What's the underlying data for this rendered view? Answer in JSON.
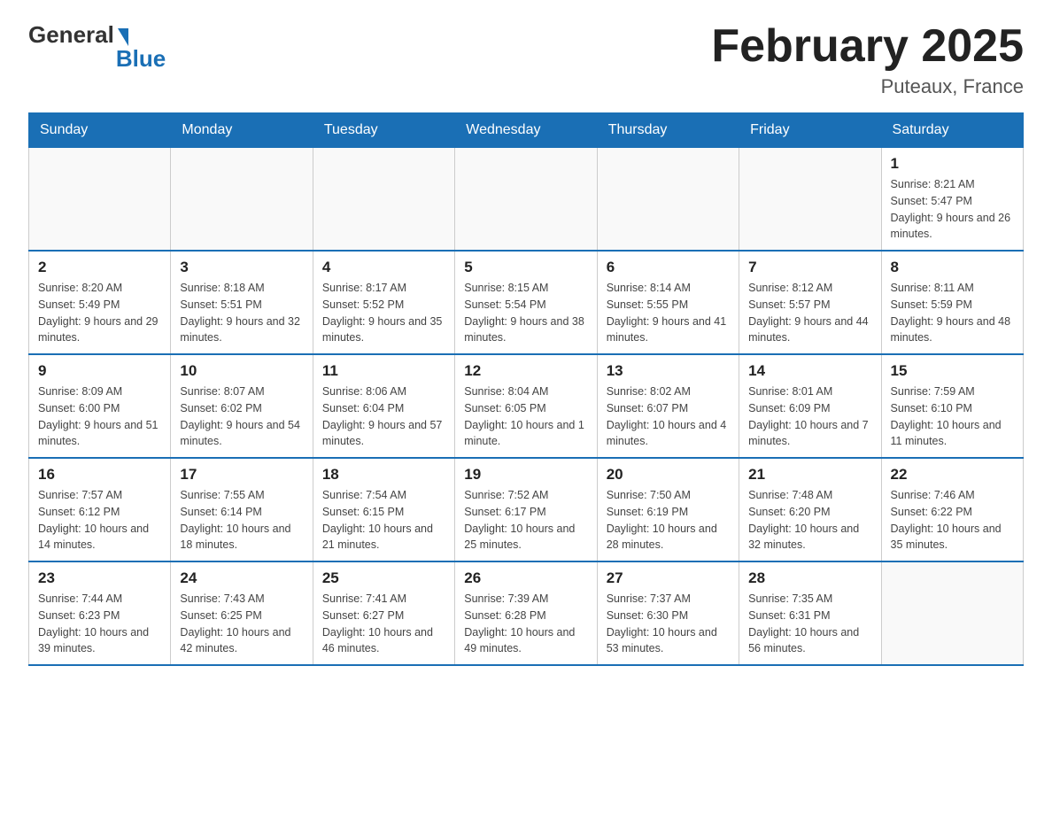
{
  "header": {
    "logo_general": "General",
    "logo_blue": "Blue",
    "title": "February 2025",
    "subtitle": "Puteaux, France"
  },
  "days_of_week": [
    "Sunday",
    "Monday",
    "Tuesday",
    "Wednesday",
    "Thursday",
    "Friday",
    "Saturday"
  ],
  "weeks": [
    [
      {
        "day": "",
        "info": ""
      },
      {
        "day": "",
        "info": ""
      },
      {
        "day": "",
        "info": ""
      },
      {
        "day": "",
        "info": ""
      },
      {
        "day": "",
        "info": ""
      },
      {
        "day": "",
        "info": ""
      },
      {
        "day": "1",
        "info": "Sunrise: 8:21 AM\nSunset: 5:47 PM\nDaylight: 9 hours and 26 minutes."
      }
    ],
    [
      {
        "day": "2",
        "info": "Sunrise: 8:20 AM\nSunset: 5:49 PM\nDaylight: 9 hours and 29 minutes."
      },
      {
        "day": "3",
        "info": "Sunrise: 8:18 AM\nSunset: 5:51 PM\nDaylight: 9 hours and 32 minutes."
      },
      {
        "day": "4",
        "info": "Sunrise: 8:17 AM\nSunset: 5:52 PM\nDaylight: 9 hours and 35 minutes."
      },
      {
        "day": "5",
        "info": "Sunrise: 8:15 AM\nSunset: 5:54 PM\nDaylight: 9 hours and 38 minutes."
      },
      {
        "day": "6",
        "info": "Sunrise: 8:14 AM\nSunset: 5:55 PM\nDaylight: 9 hours and 41 minutes."
      },
      {
        "day": "7",
        "info": "Sunrise: 8:12 AM\nSunset: 5:57 PM\nDaylight: 9 hours and 44 minutes."
      },
      {
        "day": "8",
        "info": "Sunrise: 8:11 AM\nSunset: 5:59 PM\nDaylight: 9 hours and 48 minutes."
      }
    ],
    [
      {
        "day": "9",
        "info": "Sunrise: 8:09 AM\nSunset: 6:00 PM\nDaylight: 9 hours and 51 minutes."
      },
      {
        "day": "10",
        "info": "Sunrise: 8:07 AM\nSunset: 6:02 PM\nDaylight: 9 hours and 54 minutes."
      },
      {
        "day": "11",
        "info": "Sunrise: 8:06 AM\nSunset: 6:04 PM\nDaylight: 9 hours and 57 minutes."
      },
      {
        "day": "12",
        "info": "Sunrise: 8:04 AM\nSunset: 6:05 PM\nDaylight: 10 hours and 1 minute."
      },
      {
        "day": "13",
        "info": "Sunrise: 8:02 AM\nSunset: 6:07 PM\nDaylight: 10 hours and 4 minutes."
      },
      {
        "day": "14",
        "info": "Sunrise: 8:01 AM\nSunset: 6:09 PM\nDaylight: 10 hours and 7 minutes."
      },
      {
        "day": "15",
        "info": "Sunrise: 7:59 AM\nSunset: 6:10 PM\nDaylight: 10 hours and 11 minutes."
      }
    ],
    [
      {
        "day": "16",
        "info": "Sunrise: 7:57 AM\nSunset: 6:12 PM\nDaylight: 10 hours and 14 minutes."
      },
      {
        "day": "17",
        "info": "Sunrise: 7:55 AM\nSunset: 6:14 PM\nDaylight: 10 hours and 18 minutes."
      },
      {
        "day": "18",
        "info": "Sunrise: 7:54 AM\nSunset: 6:15 PM\nDaylight: 10 hours and 21 minutes."
      },
      {
        "day": "19",
        "info": "Sunrise: 7:52 AM\nSunset: 6:17 PM\nDaylight: 10 hours and 25 minutes."
      },
      {
        "day": "20",
        "info": "Sunrise: 7:50 AM\nSunset: 6:19 PM\nDaylight: 10 hours and 28 minutes."
      },
      {
        "day": "21",
        "info": "Sunrise: 7:48 AM\nSunset: 6:20 PM\nDaylight: 10 hours and 32 minutes."
      },
      {
        "day": "22",
        "info": "Sunrise: 7:46 AM\nSunset: 6:22 PM\nDaylight: 10 hours and 35 minutes."
      }
    ],
    [
      {
        "day": "23",
        "info": "Sunrise: 7:44 AM\nSunset: 6:23 PM\nDaylight: 10 hours and 39 minutes."
      },
      {
        "day": "24",
        "info": "Sunrise: 7:43 AM\nSunset: 6:25 PM\nDaylight: 10 hours and 42 minutes."
      },
      {
        "day": "25",
        "info": "Sunrise: 7:41 AM\nSunset: 6:27 PM\nDaylight: 10 hours and 46 minutes."
      },
      {
        "day": "26",
        "info": "Sunrise: 7:39 AM\nSunset: 6:28 PM\nDaylight: 10 hours and 49 minutes."
      },
      {
        "day": "27",
        "info": "Sunrise: 7:37 AM\nSunset: 6:30 PM\nDaylight: 10 hours and 53 minutes."
      },
      {
        "day": "28",
        "info": "Sunrise: 7:35 AM\nSunset: 6:31 PM\nDaylight: 10 hours and 56 minutes."
      },
      {
        "day": "",
        "info": ""
      }
    ]
  ]
}
